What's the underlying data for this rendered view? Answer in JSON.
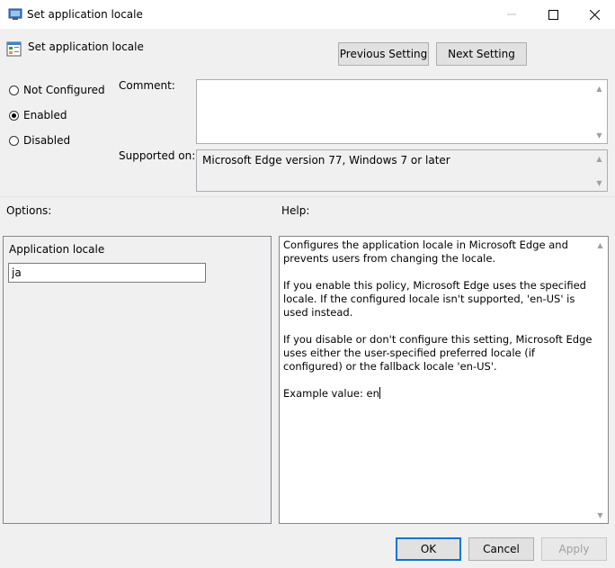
{
  "window": {
    "title": "Set application locale",
    "icons": {
      "title": "group-policy-icon",
      "minimize": "minimize-icon",
      "maximize": "maximize-icon",
      "close": "close-icon"
    }
  },
  "header": {
    "title": "Set application locale",
    "icon": "policy-setting-icon",
    "previous_label": "Previous Setting",
    "next_label": "Next Setting"
  },
  "state": {
    "not_configured": "Not Configured",
    "enabled": "Enabled",
    "disabled": "Disabled",
    "selected": "enabled"
  },
  "comment": {
    "label": "Comment:",
    "value": ""
  },
  "supported": {
    "label": "Supported on:",
    "value": "Microsoft Edge version 77, Windows 7 or later"
  },
  "options": {
    "label": "Options:",
    "field_label": "Application locale",
    "field_value": "ja"
  },
  "help": {
    "label": "Help:",
    "paragraphs": [
      "Configures the application locale in Microsoft Edge and prevents users from changing the locale.",
      "If you enable this policy, Microsoft Edge uses the specified locale. If the configured locale isn't supported, 'en-US' is used instead.",
      "If you disable or don't configure this setting, Microsoft Edge uses either the user-specified preferred locale (if configured) or the fallback locale 'en-US'.",
      "Example value: en"
    ]
  },
  "footer": {
    "ok": "OK",
    "cancel": "Cancel",
    "apply": "Apply"
  },
  "colors": {
    "accent": "#0078d7",
    "window_bg": "#f0f0f0",
    "border": "#828790"
  }
}
